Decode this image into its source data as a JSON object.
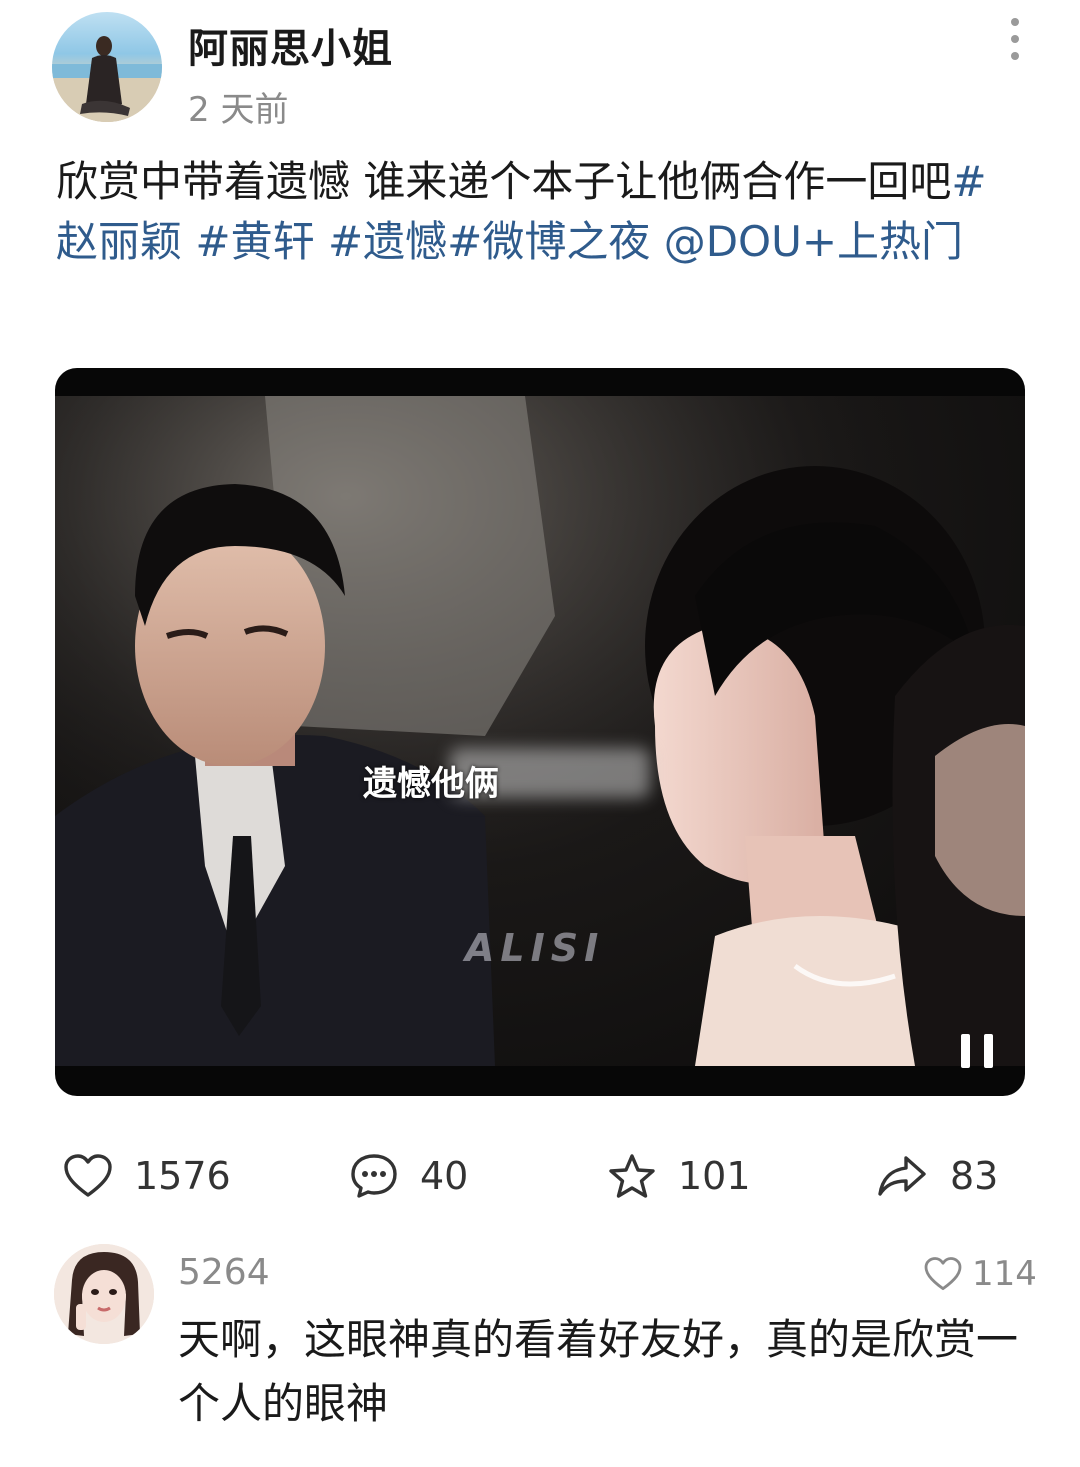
{
  "post": {
    "author": "阿丽思小姐",
    "time": "2 天前",
    "text_plain": "欣赏中带着遗憾 谁来递个本子让他俩合作一回吧",
    "tags": [
      "#赵丽颖",
      "#黄轩",
      "#遗憾",
      "#微博之夜",
      "@DOU+上热门"
    ],
    "tag_color": "#2f5b8c"
  },
  "video": {
    "subtitle": "遗憾他俩",
    "watermark": "ALISI",
    "pause_icon": "pause-icon"
  },
  "actions": {
    "like": "1576",
    "comment": "40",
    "favorite": "101",
    "share": "83"
  },
  "comment": {
    "author": "5264",
    "likes": "114",
    "text": "天啊，这眼神真的看着好友好，真的是欣赏一个人的眼神"
  },
  "colors": {
    "text": "#1a1a1a",
    "secondary": "#8a8a8a",
    "link": "#2f5b8c"
  }
}
